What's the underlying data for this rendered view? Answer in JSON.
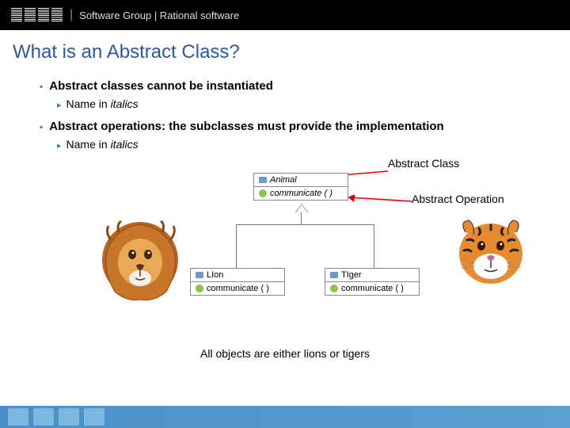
{
  "header": {
    "brand": "IBM",
    "text": "Software Group | Rational software"
  },
  "title": "What is an Abstract Class?",
  "bullets": {
    "b1": "Abstract classes cannot be instantiated",
    "s1a": "Name in ",
    "s1b": "italics",
    "b2": "Abstract operations: the subclasses must provide the implementation",
    "s2a": "Name in ",
    "s2b": "italics"
  },
  "uml": {
    "animal": "Animal",
    "animal_op": "communicate ( )",
    "lion": "LIon",
    "lion_op": "communicate ( )",
    "tiger": "TIger",
    "tiger_op": "communicate ( )"
  },
  "labels": {
    "ac": "Abstract Class",
    "ao": "Abstract Operation"
  },
  "caption": "All objects are either lions or tigers"
}
